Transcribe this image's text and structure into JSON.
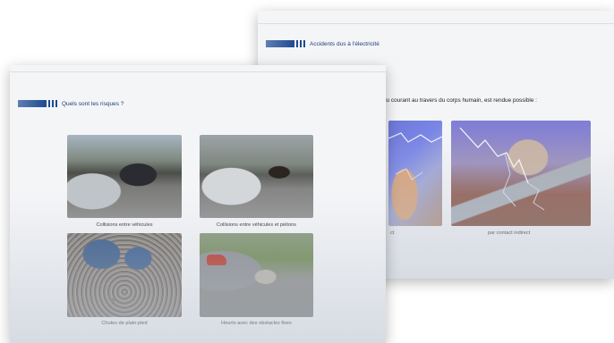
{
  "back_slide": {
    "title": "Accidents dus à l'électricité",
    "subtitle": "du courant au travers du corps humain, est rendue possible :",
    "photos": [
      {
        "caption": "ct",
        "icon": "electric-shock-direct-photo"
      },
      {
        "caption": "par contact indirect",
        "icon": "electric-shock-indirect-photo"
      }
    ]
  },
  "front_slide": {
    "title": "Quels sont les risques ?",
    "photos": [
      {
        "caption": "Collisions entre véhicules",
        "icon": "car-collision-photo"
      },
      {
        "caption": "Collisions entre véhicules et piétons",
        "icon": "pedestrian-collision-photo"
      },
      {
        "caption": "Chutes de plain-pied",
        "icon": "fall-photo"
      },
      {
        "caption": "Heurts avec des obstacles fixes",
        "icon": "fixed-obstacle-photo"
      }
    ]
  },
  "colors": {
    "title_bar": "#1e4a92",
    "title_text": "#1f3f7c",
    "slide_bg": "#f4f5f7"
  }
}
